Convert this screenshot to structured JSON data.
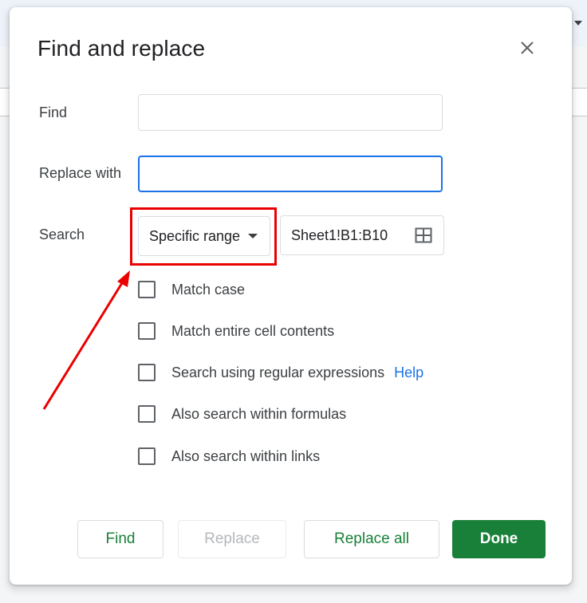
{
  "dialog": {
    "title": "Find and replace",
    "close_icon": "close-icon"
  },
  "fields": {
    "find_label": "Find",
    "find_value": "",
    "replace_label": "Replace with",
    "replace_value": "",
    "search_label": "Search",
    "search_scope": "Specific range",
    "range_value": "Sheet1!B1:B10",
    "range_icon": "grid-select-icon"
  },
  "options": [
    {
      "label": "Match case",
      "checked": false
    },
    {
      "label": "Match entire cell contents",
      "checked": false
    },
    {
      "label": "Search using regular expressions",
      "checked": false
    },
    {
      "label": "Also search within formulas",
      "checked": false
    },
    {
      "label": "Also search within links",
      "checked": false
    }
  ],
  "help_link": "Help",
  "buttons": {
    "find": "Find",
    "replace": "Replace",
    "replace_all": "Replace all",
    "done": "Done"
  },
  "colors": {
    "primary_green": "#188038",
    "focus_blue": "#1a73e8",
    "annotation_red": "#ea0000"
  }
}
